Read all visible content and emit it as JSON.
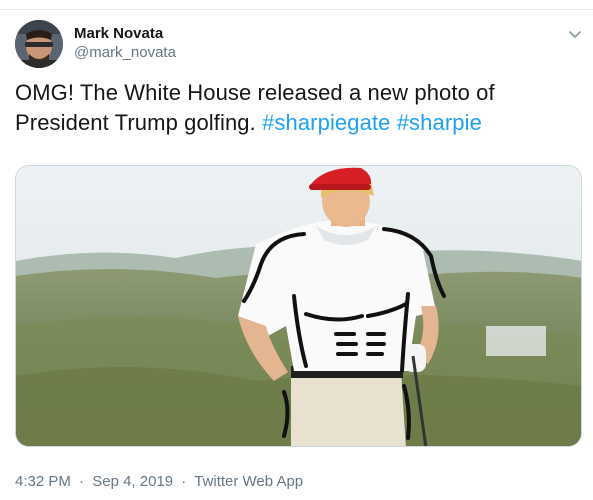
{
  "author": {
    "display_name": "Mark Novata",
    "handle": "@mark_novata"
  },
  "tweet": {
    "text": "OMG! The White House released a new photo of President Trump golfing.",
    "hashtags": [
      "#sharpiegate",
      "#sharpie"
    ]
  },
  "meta": {
    "time": "4:32 PM",
    "separator": "·",
    "date": "Sep 4, 2019",
    "source": "Twitter Web App"
  },
  "icons": {
    "more": "chevron-down-icon"
  },
  "colors": {
    "hashtag": "#1da1f2",
    "secondary_text": "#657786",
    "primary_text": "#14171a",
    "divider": "#e6ecf0"
  }
}
